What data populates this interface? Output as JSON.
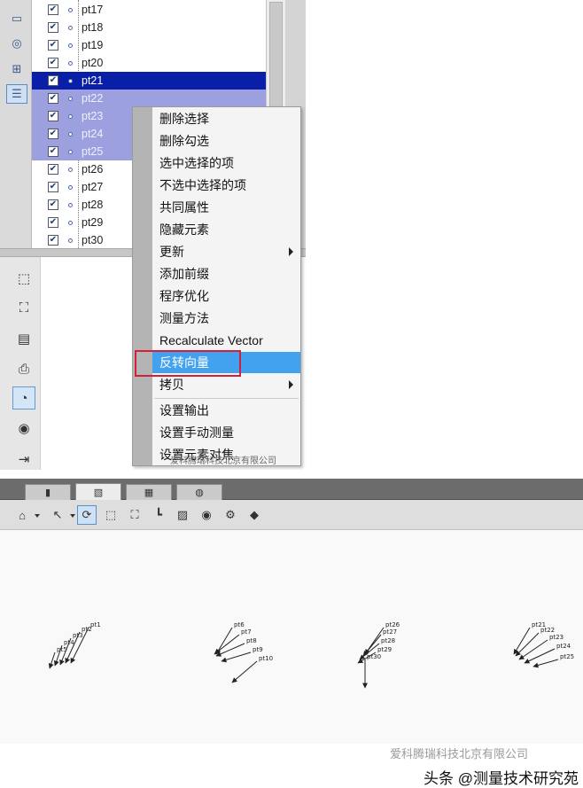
{
  "tree": {
    "rows": [
      {
        "label": "pt17",
        "state": "normal"
      },
      {
        "label": "pt18",
        "state": "normal"
      },
      {
        "label": "pt19",
        "state": "normal"
      },
      {
        "label": "pt20",
        "state": "normal"
      },
      {
        "label": "pt21",
        "state": "selected-focus"
      },
      {
        "label": "pt22",
        "state": "selected"
      },
      {
        "label": "pt23",
        "state": "selected"
      },
      {
        "label": "pt24",
        "state": "selected"
      },
      {
        "label": "pt25",
        "state": "selected"
      },
      {
        "label": "pt26",
        "state": "normal"
      },
      {
        "label": "pt27",
        "state": "normal"
      },
      {
        "label": "pt28",
        "state": "normal"
      },
      {
        "label": "pt29",
        "state": "normal"
      },
      {
        "label": "pt30",
        "state": "normal"
      }
    ],
    "check_glyph": "✔"
  },
  "context_menu": {
    "items": [
      {
        "label": "删除选择",
        "submenu": false
      },
      {
        "label": "删除勾选",
        "submenu": false
      },
      {
        "label": "选中选择的项",
        "submenu": false
      },
      {
        "label": "不选中选择的项",
        "submenu": false
      },
      {
        "label": "共同属性",
        "submenu": false
      },
      {
        "label": "隐藏元素",
        "submenu": false
      },
      {
        "label": "更新",
        "submenu": true
      },
      {
        "label": "添加前缀",
        "submenu": false
      },
      {
        "label": "程序优化",
        "submenu": false
      },
      {
        "label": "测量方法",
        "submenu": false
      },
      {
        "label": "Recalculate Vector",
        "submenu": false
      },
      {
        "label": "反转向量",
        "submenu": false,
        "highlighted": true
      },
      {
        "label": "拷贝",
        "submenu": true
      },
      {
        "label": "设置输出",
        "submenu": false
      },
      {
        "label": "设置手动测量",
        "submenu": false
      },
      {
        "label": "设置元素对焦",
        "submenu": false
      }
    ],
    "highlight_color": "#43a2f0",
    "callout_color": "#d0203a"
  },
  "watermark_top": "爱科腾瑞科技北京有限公司",
  "viewport": {
    "groups": [
      {
        "labels": [
          "pt1",
          "pt2",
          "pt3",
          "pt4",
          "pt5"
        ]
      },
      {
        "labels": [
          "pt6",
          "pt7",
          "pt8",
          "pt9",
          "pt10"
        ]
      },
      {
        "labels": [
          "pt26",
          "pt27",
          "pt28",
          "pt29",
          "pt30"
        ]
      },
      {
        "labels": [
          "pt21",
          "pt22",
          "pt23",
          "pt24",
          "pt25"
        ]
      }
    ]
  },
  "brand": {
    "faded": "爱科腾瑞科技北京有限公司",
    "caption": "头条 @测量技术研究苑"
  }
}
